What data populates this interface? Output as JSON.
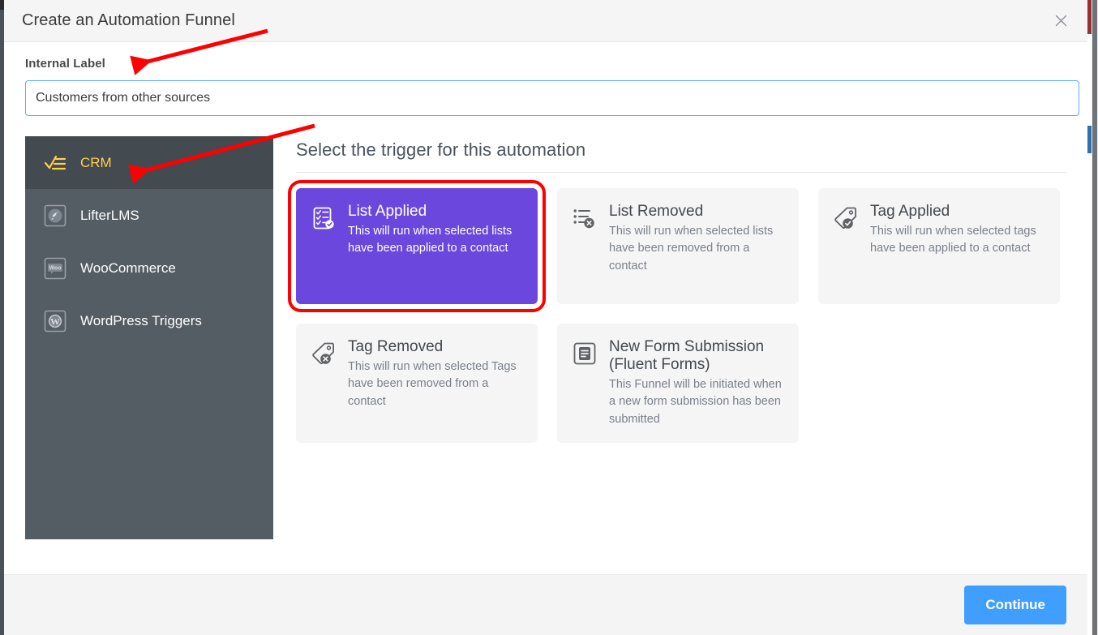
{
  "window": {
    "title": "Create an Automation Funnel",
    "close_icon": "close-icon"
  },
  "form": {
    "internal_label_label": "Internal Label",
    "internal_label_value": "Customers from other sources",
    "internal_label_placeholder": "Internal Label"
  },
  "sidebar": {
    "items": [
      {
        "label": "CRM",
        "icon": "crm-checklist-icon",
        "active": true
      },
      {
        "label": "LifterLMS",
        "icon": "lifterlms-rocket-icon",
        "active": false
      },
      {
        "label": "WooCommerce",
        "icon": "woocommerce-icon",
        "active": false
      },
      {
        "label": "WordPress Triggers",
        "icon": "wordpress-icon",
        "active": false
      }
    ]
  },
  "triggers": {
    "heading": "Select the trigger for this automation",
    "cards": [
      {
        "title": "List Applied",
        "desc": "This will run when selected lists have been applied to a contact",
        "icon": "list-check-icon",
        "selected": true
      },
      {
        "title": "List Removed",
        "desc": "This will run when selected lists have been removed from a contact",
        "icon": "list-remove-icon",
        "selected": false
      },
      {
        "title": "Tag Applied",
        "desc": "This will run when selected tags have been applied to a contact",
        "icon": "tag-check-icon",
        "selected": false
      },
      {
        "title": "Tag Removed",
        "desc": "This will run when selected Tags have been removed from a contact",
        "icon": "tag-remove-icon",
        "selected": false
      },
      {
        "title": "New Form Submission (Fluent Forms)",
        "desc": "This Funnel will be initiated when a new form submission has been submitted",
        "icon": "form-icon",
        "selected": false
      }
    ]
  },
  "footer": {
    "continue_label": "Continue"
  },
  "colors": {
    "accent_blue": "#409eff",
    "selected_purple": "#6c47dd",
    "sidebar_bg": "#545c64",
    "sidebar_active_text": "#ffd04b",
    "annotation_red": "#ff0000"
  }
}
